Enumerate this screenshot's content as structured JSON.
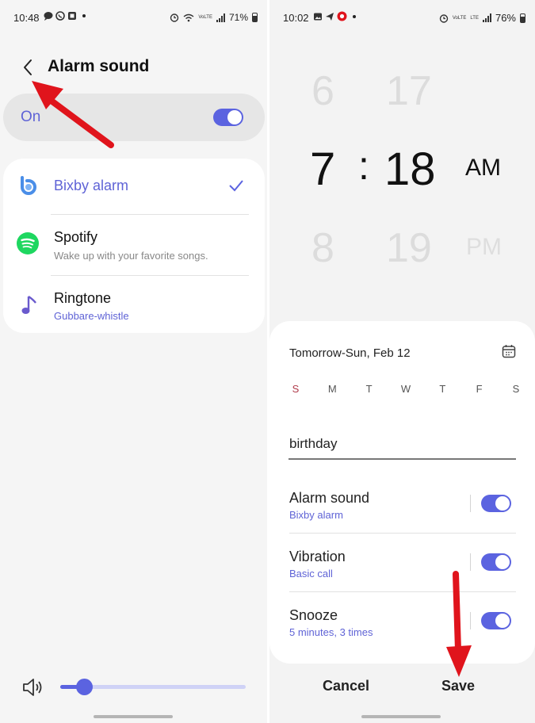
{
  "left": {
    "status": {
      "time": "10:48",
      "battery": "71%",
      "volte": "VoL\nLTE1"
    },
    "title": "Alarm sound",
    "toggle_label": "On",
    "toggle_on": true,
    "items": [
      {
        "name": "Bixby alarm",
        "sub": "",
        "selected": true,
        "icon": "bixby-icon"
      },
      {
        "name": "Spotify",
        "sub": "Wake up with your favorite songs.",
        "selected": false,
        "icon": "spotify-icon"
      },
      {
        "name": "Ringtone",
        "sub": "Gubbare-whistle",
        "selected": false,
        "icon": "music-note-icon"
      }
    ],
    "volume_level": 0.14,
    "accent": "#5b63e0",
    "arrow_color": "#e0141c"
  },
  "right": {
    "status": {
      "time": "10:02",
      "battery": "76%",
      "volte": "VoL\nLTE1"
    },
    "picker": {
      "hour_prev": "6",
      "hour": "7",
      "hour_next": "8",
      "separator": ":",
      "minute_prev": "17",
      "minute": "18",
      "minute_next": "19",
      "ampm": "AM",
      "ampm_next": "PM"
    },
    "date": "Tomorrow-Sun, Feb 12",
    "days": [
      "S",
      "M",
      "T",
      "W",
      "T",
      "F",
      "S"
    ],
    "alarm_name": "birthday",
    "options": [
      {
        "title": "Alarm sound",
        "sub": "Bixby alarm",
        "on": true
      },
      {
        "title": "Vibration",
        "sub": "Basic call",
        "on": true
      },
      {
        "title": "Snooze",
        "sub": "5 minutes, 3 times",
        "on": true
      }
    ],
    "cancel_label": "Cancel",
    "save_label": "Save"
  }
}
